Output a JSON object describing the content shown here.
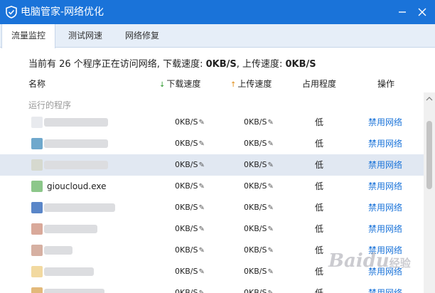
{
  "window": {
    "title": "电脑管家-网络优化",
    "minimize_icon": "minimize-icon",
    "close_icon": "close-icon"
  },
  "tabs": [
    {
      "label": "流量监控",
      "active": true
    },
    {
      "label": "测试网速",
      "active": false
    },
    {
      "label": "网络修复",
      "active": false
    }
  ],
  "summary": {
    "prefix": "当前有 26 个程序正在访问网络, 下载速度: ",
    "download": "0KB/S",
    "middle": ", 上传速度: ",
    "upload": "0KB/S"
  },
  "columns": {
    "name": "名称",
    "download": "下载速度",
    "upload": "上传速度",
    "usage": "占用程度",
    "operation": "操作"
  },
  "section_label": "运行的程序",
  "rows": [
    {
      "name": "",
      "icon_color": "#e8eaee",
      "download": "0KB/S",
      "upload": "0KB/S",
      "usage": "低",
      "action": "禁用网络",
      "selected": false
    },
    {
      "name": "",
      "icon_color": "#6fa8cc",
      "download": "0KB/S",
      "upload": "0KB/S",
      "usage": "低",
      "action": "禁用网络",
      "selected": false
    },
    {
      "name": "",
      "icon_color": "#d6d9cf",
      "download": "0KB/S",
      "upload": "0KB/S",
      "usage": "低",
      "action": "禁用网络",
      "selected": true
    },
    {
      "name": "gioucloud.exe",
      "icon_color": "#8cc78a",
      "download": "0KB/S",
      "upload": "0KB/S",
      "usage": "低",
      "action": "禁用网络",
      "selected": false
    },
    {
      "name": "",
      "icon_color": "#5a86c8",
      "download": "0KB/S",
      "upload": "0KB/S",
      "usage": "低",
      "action": "禁用网络",
      "selected": false
    },
    {
      "name": "",
      "icon_color": "#d9a99a",
      "download": "0KB/S",
      "upload": "0KB/S",
      "usage": "低",
      "action": "禁用网络",
      "selected": false
    },
    {
      "name": "",
      "icon_color": "#d6b0a2",
      "download": "0KB/S",
      "upload": "0KB/S",
      "usage": "低",
      "action": "禁用网络",
      "selected": false
    },
    {
      "name": "",
      "icon_color": "#f2d9a0",
      "download": "0KB/S",
      "upload": "0KB/S",
      "usage": "低",
      "action": "禁用网络",
      "selected": false
    },
    {
      "name": "",
      "icon_color": "#e3b97a",
      "download": "0KB/S",
      "upload": "0KB/S",
      "usage": "低",
      "action": "禁用网络",
      "selected": false
    }
  ],
  "watermark": {
    "text": "Baidu",
    "suffix": "经验"
  },
  "colors": {
    "titlebar": "#1a73d9",
    "link": "#1a73d9",
    "selected_row": "#e1e8f2"
  }
}
